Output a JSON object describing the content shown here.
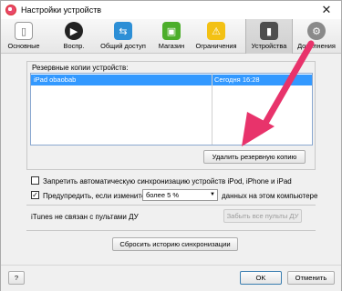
{
  "window": {
    "title": "Настройки устройств",
    "close_glyph": "✕"
  },
  "toolbar": {
    "items": [
      {
        "label": "Основные",
        "icon": "general-icon"
      },
      {
        "label": "Воспр.",
        "icon": "play-icon"
      },
      {
        "label": "Общий доступ",
        "icon": "share-icon"
      },
      {
        "label": "Магазин",
        "icon": "store-icon"
      },
      {
        "label": "Ограничения",
        "icon": "limits-icon"
      },
      {
        "label": "Устройства",
        "icon": "devices-icon",
        "active": true
      },
      {
        "label": "Дополнения",
        "icon": "extras-icon"
      }
    ]
  },
  "backups": {
    "heading": "Резервные копии устройств:",
    "rows": [
      {
        "device": "iPad obaobab",
        "date": "Сегодня 16:28",
        "selected": true
      }
    ],
    "delete_button": "Удалить резервную копию"
  },
  "options": {
    "prevent_sync_label": "Запретить автоматическую синхронизацию устройств iPod, iPhone и iPad",
    "prevent_sync_checked": false,
    "warn_label": "Предупредить, если изменится",
    "warn_checked": true,
    "warn_select_value": "более 5 %",
    "warn_suffix": "данных на этом компьютере"
  },
  "remotes": {
    "status": "iTunes не связан с пультами ДУ",
    "forget_button": "Забыть все пульты ДУ"
  },
  "reset_sync_button": "Сбросить историю синхронизации",
  "footer": {
    "help_button": "?",
    "ok_button": "OK",
    "cancel_button": "Отменить"
  },
  "colors": {
    "selection": "#3399ff",
    "annotation_arrow": "#e8336b"
  }
}
